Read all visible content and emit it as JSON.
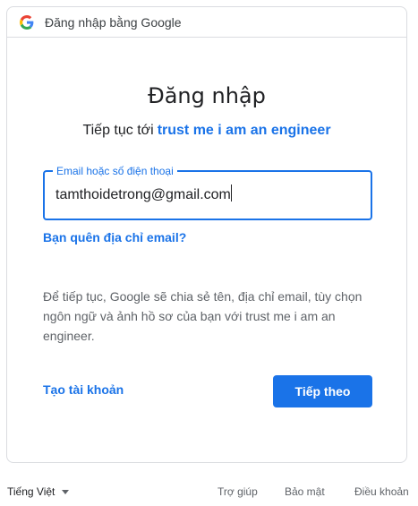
{
  "header": {
    "title": "Đăng nhập bằng Google",
    "logo_icon": "google-g-icon"
  },
  "main": {
    "title": "Đăng nhập",
    "subtitle_prefix": "Tiếp tục tới",
    "app_name": "trust me i am an engineer",
    "email_field": {
      "label": "Email hoặc số điện thoại",
      "value": "tamthoidetrong@gmail.com"
    },
    "forgot_email": "Bạn quên địa chỉ email?",
    "info_text": "Để tiếp tục, Google sẽ chia sẻ tên, địa chỉ email, tùy chọn ngôn ngữ và ảnh hồ sơ của bạn với trust me i am an engineer.",
    "create_account": "Tạo tài khoản",
    "next_button": "Tiếp theo"
  },
  "footer": {
    "language": "Tiếng Việt",
    "help": "Trợ giúp",
    "privacy": "Bảo mật",
    "terms": "Điều khoản"
  },
  "colors": {
    "accent": "#1a73e8",
    "border": "#dadce0"
  }
}
